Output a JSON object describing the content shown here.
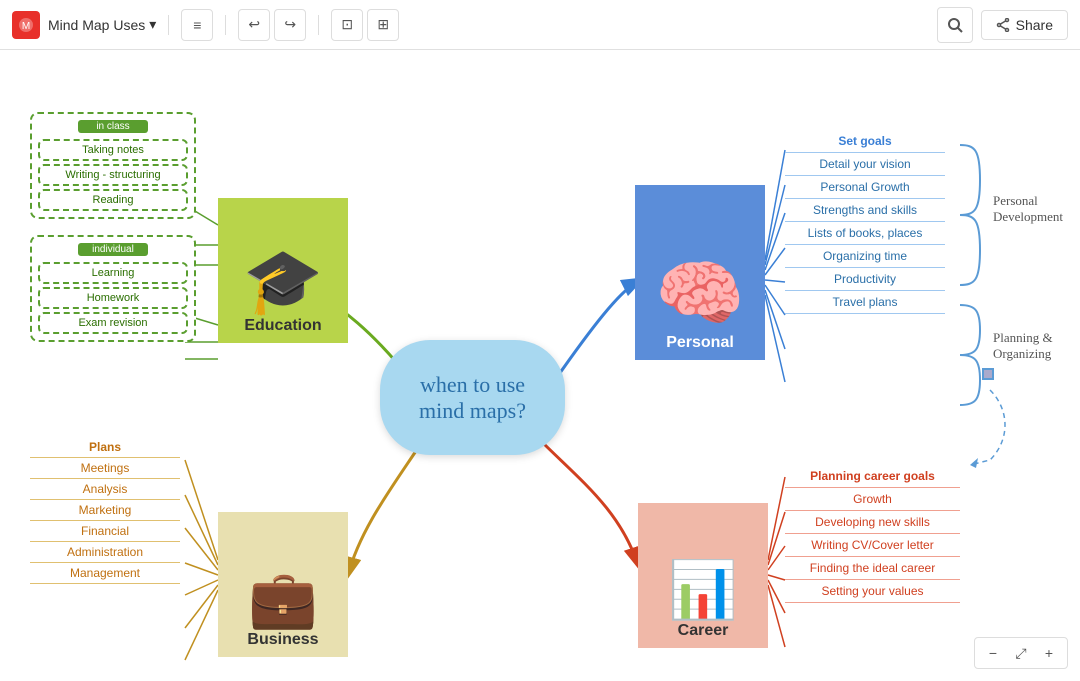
{
  "header": {
    "app_name": "Mind Map Uses",
    "dropdown_arrow": "▾",
    "menu_icon": "≡",
    "undo_label": "←",
    "redo_label": "→",
    "search_label": "🔍",
    "share_label": "Share"
  },
  "center": {
    "text": "when to use\nmind maps?"
  },
  "education": {
    "label": "Education",
    "in_class": {
      "group": "in class",
      "items": [
        "Taking notes",
        "Writing - structuring",
        "Reading"
      ]
    },
    "individual": {
      "group": "individual",
      "items": [
        "Learning",
        "Homework",
        "Exam revision"
      ]
    }
  },
  "personal": {
    "label": "Personal",
    "leaves": [
      "Set goals",
      "Detail your vision",
      "Personal Growth",
      "Strengths and skills",
      "Lists of books, places",
      "Organizing time",
      "Productivity",
      "Travel plans"
    ],
    "personal_development_label": "Personal\nDevelopment",
    "planning_label": "Planning &\nOrganizing"
  },
  "career": {
    "label": "Career",
    "leaves": [
      "Planning career goals",
      "Growth",
      "Developing new skills",
      "Writing CV/Cover letter",
      "Finding the ideal career",
      "Setting  your values"
    ]
  },
  "business": {
    "label": "Business",
    "leaves": [
      "Plans",
      "Meetings",
      "Analysis",
      "Marketing",
      "Financial",
      "Administration",
      "Management"
    ]
  },
  "bottom_bar": {
    "zoom_out": "−",
    "fit": "⤢",
    "zoom_in": "+"
  }
}
